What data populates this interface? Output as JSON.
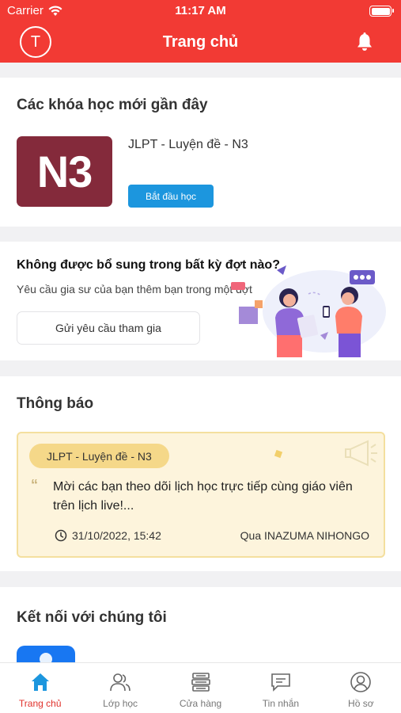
{
  "status_bar": {
    "carrier": "Carrier",
    "time": "11:17 AM"
  },
  "header": {
    "avatar_initial": "T",
    "title": "Trang chủ"
  },
  "recent_courses": {
    "heading": "Các khóa học mới gần đây",
    "course": {
      "thumb_text": "N3",
      "name": "JLPT - Luyện đề - N3",
      "start_label": "Bắt đầu học"
    }
  },
  "join": {
    "title": "Không được bổ sung trong bất kỳ đợt nào?",
    "subtitle": "Yêu cầu gia sư của bạn thêm bạn trong một đợt",
    "button_label": "Gửi yêu cầu tham gia"
  },
  "notifications": {
    "heading": "Thông báo",
    "item": {
      "course_tag": "JLPT - Luyện đề - N3",
      "message": "Mời các bạn theo dõi lịch học trực tiếp cùng giáo viên trên lịch live!...",
      "datetime": "31/10/2022, 15:42",
      "source": "Qua INAZUMA NIHONGO"
    }
  },
  "connect": {
    "heading": "Kết nối với chúng tôi"
  },
  "tabs": [
    {
      "label": "Trang chủ",
      "icon": "home-icon",
      "active": true
    },
    {
      "label": "Lớp học",
      "icon": "users-icon",
      "active": false
    },
    {
      "label": "Cửa hàng",
      "icon": "books-icon",
      "active": false
    },
    {
      "label": "Tin nhắn",
      "icon": "message-icon",
      "active": false
    },
    {
      "label": "Hồ sơ",
      "icon": "profile-icon",
      "active": false
    }
  ],
  "colors": {
    "primary": "#f23a34",
    "accent_blue": "#1c96de",
    "thumb_bg": "#842a3b",
    "notice_bg": "#fdf4dc",
    "pill_bg": "#f5d889"
  }
}
